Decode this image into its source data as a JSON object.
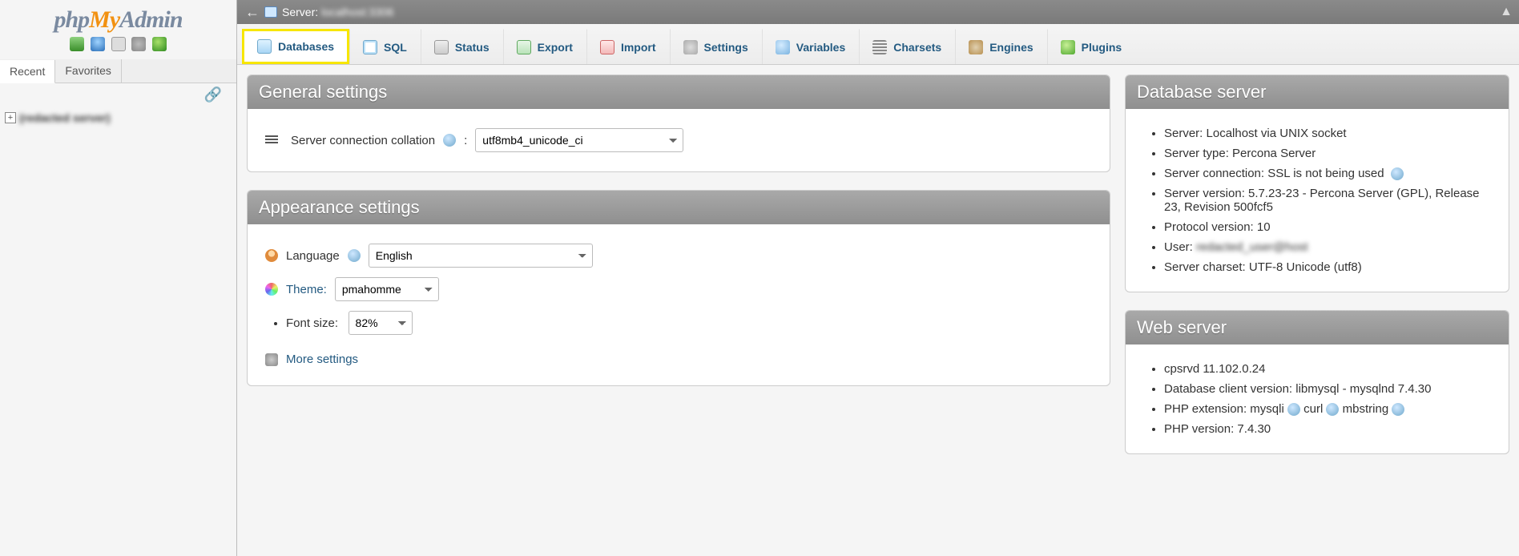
{
  "app": {
    "title": "phpMyAdmin",
    "logo_parts": {
      "php": "php",
      "my": "My",
      "admin": "Admin"
    }
  },
  "sidebar": {
    "tabs": {
      "recent": "Recent",
      "favorites": "Favorites"
    },
    "tree": {
      "root_label": "(redacted server)"
    }
  },
  "topbar": {
    "server_prefix": "Server:",
    "server_name": "localhost:3306"
  },
  "tabs": [
    {
      "key": "databases",
      "label": "Databases",
      "icon": "db",
      "active": true
    },
    {
      "key": "sql",
      "label": "SQL",
      "icon": "sql",
      "active": false
    },
    {
      "key": "status",
      "label": "Status",
      "icon": "status",
      "active": false
    },
    {
      "key": "export",
      "label": "Export",
      "icon": "export",
      "active": false
    },
    {
      "key": "import",
      "label": "Import",
      "icon": "import",
      "active": false
    },
    {
      "key": "settings",
      "label": "Settings",
      "icon": "settings",
      "active": false
    },
    {
      "key": "variables",
      "label": "Variables",
      "icon": "vars",
      "active": false
    },
    {
      "key": "charsets",
      "label": "Charsets",
      "icon": "charsets",
      "active": false
    },
    {
      "key": "engines",
      "label": "Engines",
      "icon": "engines",
      "active": false
    },
    {
      "key": "plugins",
      "label": "Plugins",
      "icon": "plugins",
      "active": false
    }
  ],
  "general": {
    "heading": "General settings",
    "collation_label": "Server connection collation",
    "collation_value": "utf8mb4_unicode_ci"
  },
  "appearance": {
    "heading": "Appearance settings",
    "language_label": "Language",
    "language_value": "English",
    "theme_label": "Theme:",
    "theme_value": "pmahomme",
    "fontsize_label": "Font size:",
    "fontsize_value": "82%",
    "more_settings": "More settings"
  },
  "db_server": {
    "heading": "Database server",
    "items": [
      "Server: Localhost via UNIX socket",
      "Server type: Percona Server",
      "Server connection: SSL is not being used",
      "Server version: 5.7.23-23 - Percona Server (GPL), Release 23, Revision 500fcf5",
      "Protocol version: 10",
      "User:",
      "Server charset: UTF-8 Unicode (utf8)"
    ],
    "user_redacted": "redacted_user@host"
  },
  "web_server": {
    "heading": "Web server",
    "items": [
      "cpsrvd 11.102.0.24",
      "Database client version: libmysql - mysqlnd 7.4.30",
      "PHP extension: mysqli  curl  mbstring",
      "PHP version: 7.4.30"
    ]
  }
}
